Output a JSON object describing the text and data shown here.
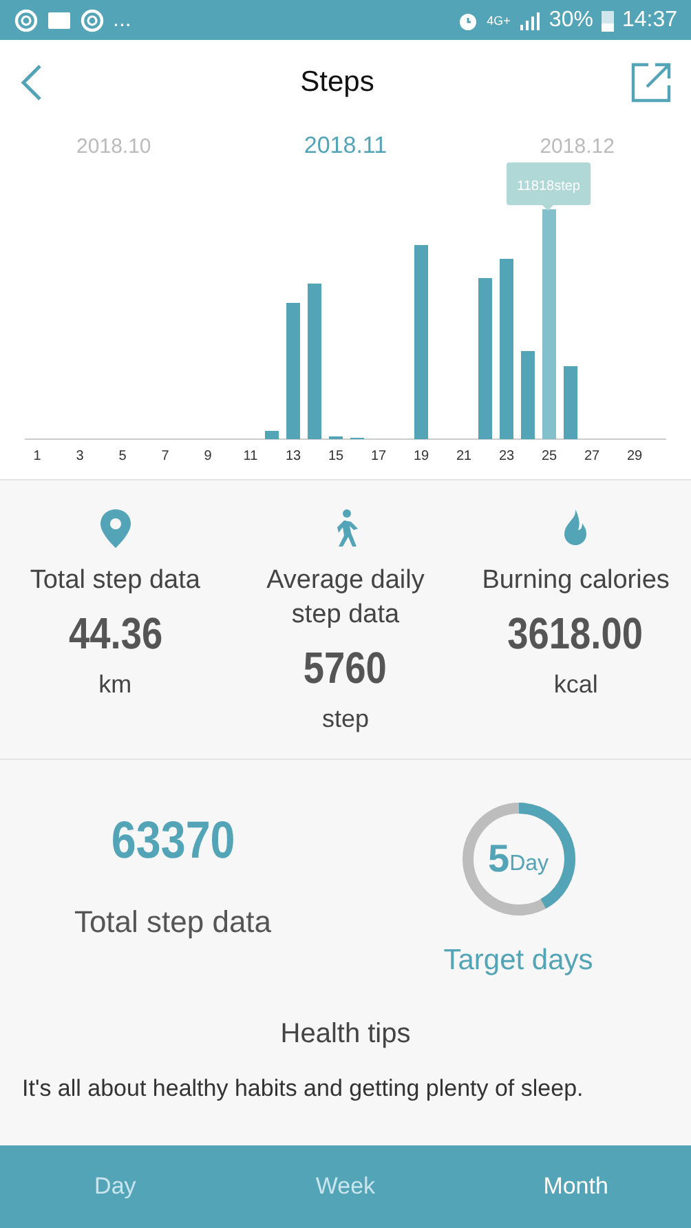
{
  "status_bar": {
    "more": "...",
    "network": "4G+",
    "battery": "30%",
    "time": "14:37"
  },
  "header": {
    "title": "Steps"
  },
  "months": [
    {
      "label": "2018.10",
      "selected": false
    },
    {
      "label": "2018.11",
      "selected": true
    },
    {
      "label": "2018.12",
      "selected": false
    }
  ],
  "chart": {
    "tooltip": "11818step",
    "day_labels": [
      "1",
      "3",
      "5",
      "7",
      "9",
      "11",
      "13",
      "15",
      "17",
      "19",
      "21",
      "23",
      "25",
      "27",
      "29"
    ]
  },
  "stats": [
    {
      "kind": "pin",
      "label": "Total step data",
      "value": "44.36",
      "unit": "km"
    },
    {
      "kind": "walk",
      "label": "Average daily step data",
      "value": "5760",
      "unit": "step"
    },
    {
      "kind": "flame",
      "label": "Burning calories",
      "value": "3618.00",
      "unit": "kcal"
    }
  ],
  "summary": {
    "total": "63370",
    "total_label": "Total step data",
    "days": "5",
    "days_unit": "Day",
    "days_label": "Target days"
  },
  "tips": {
    "title": "Health tips",
    "text": "It's all about healthy habits and getting plenty of sleep."
  },
  "bottom_tabs": [
    {
      "label": "Day",
      "selected": false
    },
    {
      "label": "Week",
      "selected": false
    },
    {
      "label": "Month",
      "selected": true
    }
  ]
}
